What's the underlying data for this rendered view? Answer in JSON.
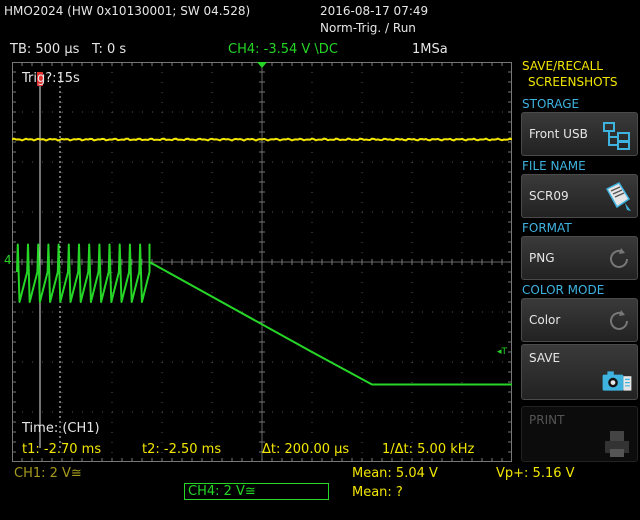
{
  "header": {
    "device": "HMO2024 (HW 0x10130001; SW 04.528)",
    "datetime": "2016-08-17 07:49",
    "trigger_mode": "Norm-Trig. / Run"
  },
  "status": {
    "timebase": "TB: 500 µs",
    "time_offset": "T: 0 s",
    "trigger_info": "CH4: -3.54 V \\DC",
    "sample_rate": "1MSa"
  },
  "plot": {
    "trig_label": "Trig?:15s",
    "time_label": "Time: (CH1)",
    "t1": "t1: -2.70 ms",
    "t2": "t2: -2.50 ms",
    "dt": "Δt: 200.00 µs",
    "freq": "1/Δt: 5.00 kHz",
    "ch4_marker": "4",
    "trig_level_marker": "◂T"
  },
  "chart_data": {
    "type": "line",
    "xlim_div": [
      0,
      10
    ],
    "ylim_div": [
      0,
      8
    ],
    "grid": true,
    "series": [
      {
        "name": "CH1",
        "color": "#f2e600",
        "x": [
          0,
          10
        ],
        "y": [
          6.45,
          6.45
        ]
      },
      {
        "name": "CH4",
        "color": "#26d626",
        "sawtooth": {
          "x_start": 0.1,
          "x_end": 2.75,
          "cycles": 13,
          "y_top": 4.35,
          "y_bottom": 3.2
        },
        "x": [
          2.75,
          6.0,
          7.2,
          10.0
        ],
        "y": [
          4.0,
          2.2,
          1.55,
          1.55
        ]
      }
    ]
  },
  "sidebar": {
    "title_line1": "SAVE/RECALL",
    "title_line2": "SCREENSHOTS",
    "storage_header": "STORAGE",
    "storage_value": "Front USB",
    "filename_header": "FILE NAME",
    "filename_value": "SCR09",
    "format_header": "FORMAT",
    "format_value": "PNG",
    "colormode_header": "COLOR MODE",
    "colormode_value": "Color",
    "save_label": "SAVE",
    "print_label": "PRINT"
  },
  "bottom": {
    "ch1": "CH1: 2 V≅",
    "ch4": "CH4: 2 V≅",
    "mean1": "Mean: 5.04 V",
    "vp": "Vp+: 5.16 V",
    "mean2": "Mean: ?"
  },
  "colors": {
    "ch1": "#f2e600",
    "ch4": "#26d626",
    "menu_header": "#3fb3e0",
    "button_bg": "#2e2e2e"
  }
}
